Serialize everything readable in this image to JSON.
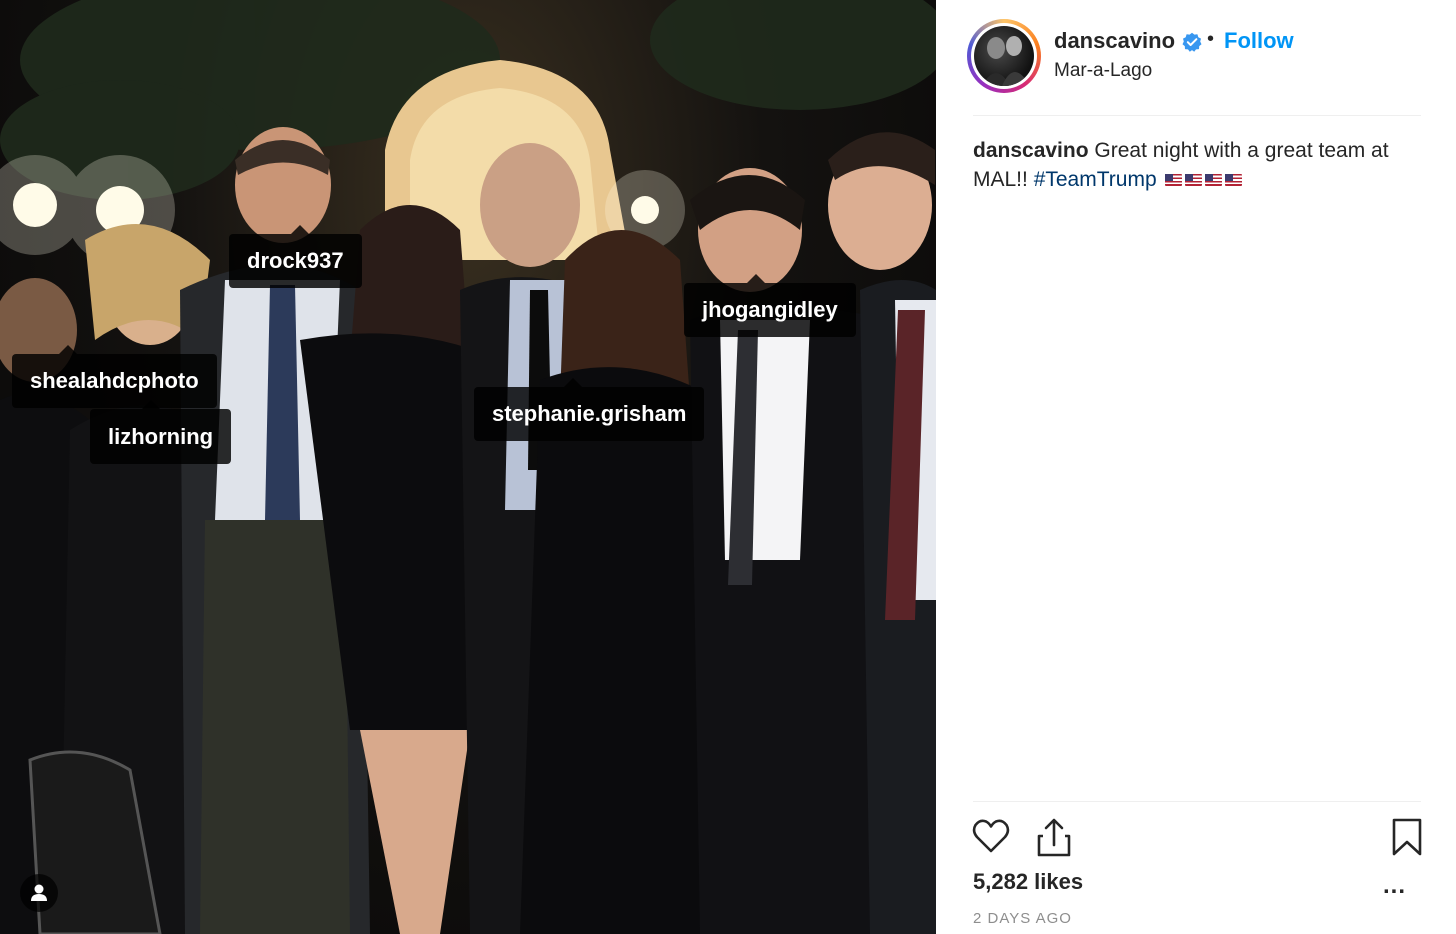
{
  "post": {
    "photo_tags": [
      {
        "label": "drock937"
      },
      {
        "label": "shealahdcphoto"
      },
      {
        "label": "lizhorning"
      },
      {
        "label": "stephanie.grisham"
      },
      {
        "label": "jhogangidley"
      }
    ]
  },
  "header": {
    "username": "danscavino",
    "separator": "•",
    "follow_label": "Follow",
    "location": "Mar-a-Lago"
  },
  "caption": {
    "username": "danscavino",
    "text": "Great night with a great team at MAL!!",
    "hashtag": "#TeamTrump"
  },
  "actions": {
    "likes": "5,282 likes",
    "timestamp": "2 DAYS AGO",
    "more_label": "..."
  },
  "colors": {
    "follow": "#0095f6",
    "hashtag": "#00376b",
    "text": "#262626",
    "muted": "#8e8e8e",
    "verified": "#3897f0"
  }
}
